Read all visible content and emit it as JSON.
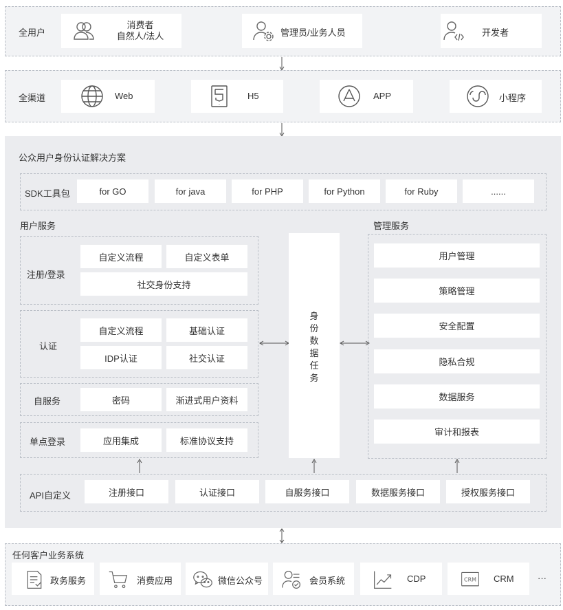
{
  "row_users": {
    "label": "全用户",
    "items": [
      {
        "line1": "消费者",
        "line2": "自然人/法人",
        "icon": "users-icon"
      },
      {
        "line1": "管理员/业务人员",
        "icon": "admin-gear-icon"
      },
      {
        "line1": "开发者",
        "icon": "developer-icon"
      }
    ]
  },
  "row_channels": {
    "label": "全渠道",
    "items": [
      {
        "label": "Web",
        "icon": "globe-icon"
      },
      {
        "label": "H5",
        "icon": "html5-icon"
      },
      {
        "label": "APP",
        "icon": "app-store-icon"
      },
      {
        "label": "小程序",
        "icon": "mini-program-icon"
      }
    ]
  },
  "solution": {
    "title": "公众用户身份认证解决方案",
    "sdk": {
      "label": "SDK工具包",
      "items": [
        "for GO",
        "for java",
        "for PHP",
        "for Python",
        "for Ruby",
        "......"
      ]
    },
    "user_services": {
      "title": "用户服务",
      "register": {
        "label": "注册/登录",
        "items": [
          "自定义流程",
          "自定义表单",
          "社交身份支持"
        ]
      },
      "auth": {
        "label": "认证",
        "items": [
          "自定义流程",
          "基础认证",
          "IDP认证",
          "社交认证"
        ]
      },
      "self": {
        "label": "自服务",
        "items": [
          "密码",
          "渐进式用户资料"
        ]
      },
      "sso": {
        "label": "单点登录",
        "items": [
          "应用集成",
          "标准协议支持"
        ]
      }
    },
    "identity_task": {
      "chars": [
        "身",
        "份",
        "数",
        "据",
        "任",
        "务"
      ]
    },
    "mgmt_services": {
      "title": "管理服务",
      "items": [
        "用户管理",
        "策略管理",
        "安全配置",
        "隐私合规",
        "数据服务",
        "审计和报表"
      ]
    },
    "api": {
      "label": "API自定义",
      "items": [
        "注册接口",
        "认证接口",
        "自服务接口",
        "数据服务接口",
        "授权服务接口"
      ]
    }
  },
  "business": {
    "title": "任何客户业务系统",
    "items": [
      {
        "label": "政务服务",
        "icon": "document-icon"
      },
      {
        "label": "消费应用",
        "icon": "cart-icon"
      },
      {
        "label": "微信公众号",
        "icon": "wechat-icon"
      },
      {
        "label": "会员系统",
        "icon": "member-icon"
      },
      {
        "label": "CDP",
        "icon": "chart-up-icon"
      },
      {
        "label": "CRM",
        "icon": "crm-icon"
      }
    ],
    "more": "···"
  }
}
